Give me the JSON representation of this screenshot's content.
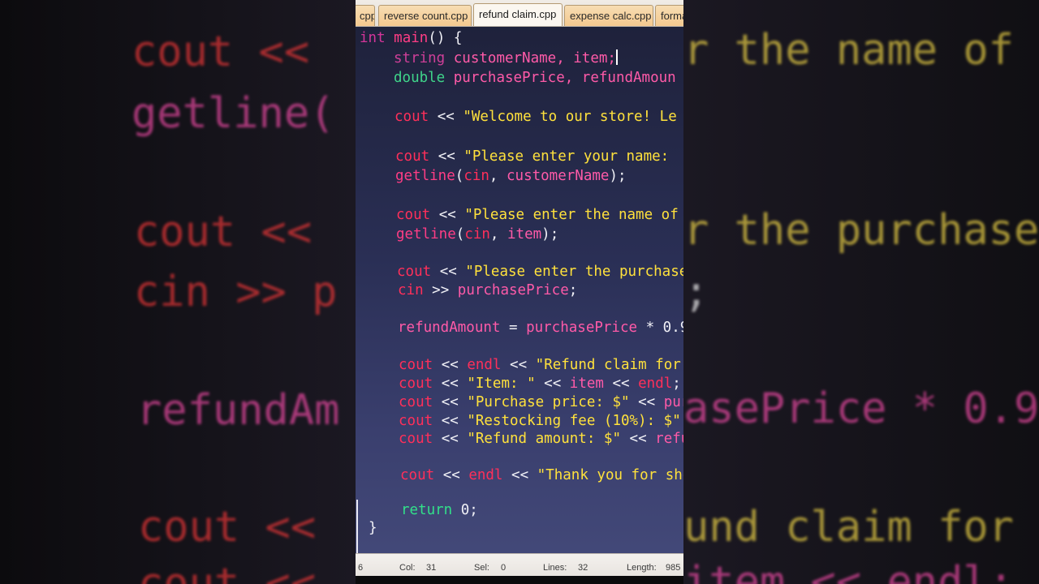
{
  "tabs": [
    {
      "label": "cpp",
      "active": false
    },
    {
      "label": "reverse count.cpp",
      "active": false
    },
    {
      "label": "refund claim.cpp",
      "active": true
    },
    {
      "label": "expense calc.cpp",
      "active": false
    },
    {
      "label": "forma",
      "active": false
    }
  ],
  "code": {
    "l1": {
      "kw": "int",
      "fn": "main",
      "rest": "() {"
    },
    "l2": {
      "ty": "string",
      "vars": "customerName, item;"
    },
    "l3": {
      "ty": "double",
      "vars": "purchasePrice, refundAmoun"
    },
    "l4": {
      "co": "cout",
      "op": "<<",
      "st": "\"Welcome to our store! Le"
    },
    "l5": {
      "co": "cout",
      "op": "<<",
      "st": "\"Please enter your name: "
    },
    "l6": {
      "fn": "getline",
      "a": "cin",
      "b": "customerName",
      "end": ");"
    },
    "l7": {
      "co": "cout",
      "op": "<<",
      "st": "\"Please enter the name of"
    },
    "l8": {
      "fn": "getline",
      "a": "cin",
      "b": "item",
      "end": ");"
    },
    "l9": {
      "co": "cout",
      "op": "<<",
      "st": "\"Please enter the purchase"
    },
    "l10": {
      "co": "cin",
      "op": ">>",
      "va": "purchasePrice",
      "end": ";"
    },
    "l11": {
      "va": "refundAmount",
      "op": "=",
      "vb": "purchasePrice",
      "tail": "* 0.9"
    },
    "l12": {
      "co": "cout",
      "op": "<<",
      "c2": "endl",
      "st": "\"Refund claim for"
    },
    "l13": {
      "co": "cout",
      "op": "<<",
      "st": "\"Item: \"",
      "va": "item",
      "c2": "endl",
      "end": ";"
    },
    "l14": {
      "co": "cout",
      "op": "<<",
      "st": "\"Purchase price: $\"",
      "va": "pur"
    },
    "l15": {
      "co": "cout",
      "op": "<<",
      "st": "\"Restocking fee (10%): $\""
    },
    "l16": {
      "co": "cout",
      "op": "<<",
      "st": "\"Refund amount: $\"",
      "va": "refu"
    },
    "l17": {
      "co": "cout",
      "op": "<<",
      "c2": "endl",
      "st": "\"Thank you for sho"
    },
    "l18": {
      "kw": "return",
      "rest": "0;"
    },
    "l19": {
      "rest": "}"
    }
  },
  "status": {
    "line": "6",
    "col_label": "Col:",
    "col": "31",
    "sel_label": "Sel:",
    "sel": "0",
    "lines_label": "Lines:",
    "lines": "32",
    "length_label": "Length:",
    "length": "985"
  },
  "backdrop": {
    "left": [
      "cout <<",
      "getline(",
      "cout <<",
      "cin >> p",
      "refundAm",
      "cout <<",
      "cout <<"
    ],
    "right": [
      "r the name of",
      "r the purchase",
      ";",
      "asePrice * 0.9",
      "und claim for",
      "item << endl;"
    ]
  },
  "colors": {
    "keyword": "#d4359a",
    "stream": "#ff2f5a",
    "string": "#ffe13c",
    "return": "#32e08a"
  }
}
